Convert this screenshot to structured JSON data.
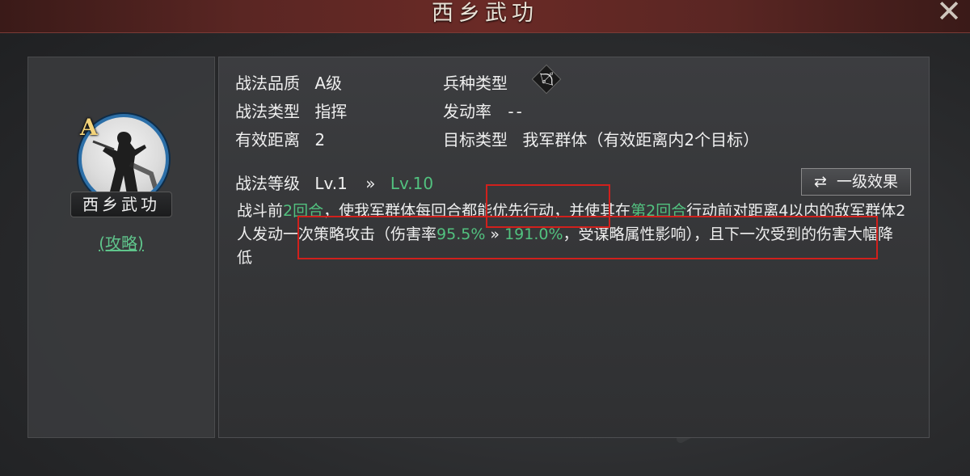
{
  "window": {
    "title": "西乡武功",
    "close_label": "✕"
  },
  "skill_card": {
    "grade": "A",
    "name": "西乡武功",
    "guide_link": "(攻略)"
  },
  "info": {
    "quality_label": "战法品质",
    "quality_value": "A级",
    "troop_label": "兵种类型",
    "troop_icon": "bow-icon",
    "type_label": "战法类型",
    "type_value": "指挥",
    "rate_label": "发动率",
    "rate_value": "--",
    "range_label": "有效距离",
    "range_value": "2",
    "target_label": "目标类型",
    "target_value": "我军群体（有效距离内2个目标）"
  },
  "level": {
    "label": "战法等级",
    "current": "Lv.1",
    "arrow": "»",
    "max": "Lv.10"
  },
  "effect_button": {
    "icon": "swap-icon",
    "icon_glyph": "⇄",
    "label": "一级效果"
  },
  "description": {
    "p1": "战斗前",
    "h1": "2回合",
    "p2": "，使我军群体每回合都能优先行动，并使其在",
    "h2": "第2回合",
    "p3": "行动前对距离4以内的敌军群体2人发动一次策略攻击（伤害率",
    "h3": "95.5%",
    "arrow": " » ",
    "h4": "191.0%",
    "p4": "，受谋略属性影响），且下一次受到的伤害大幅降低"
  },
  "colors": {
    "highlight_green": "#52c17f",
    "annotation_red": "#d1201c",
    "title_bar": "#5a2623"
  }
}
